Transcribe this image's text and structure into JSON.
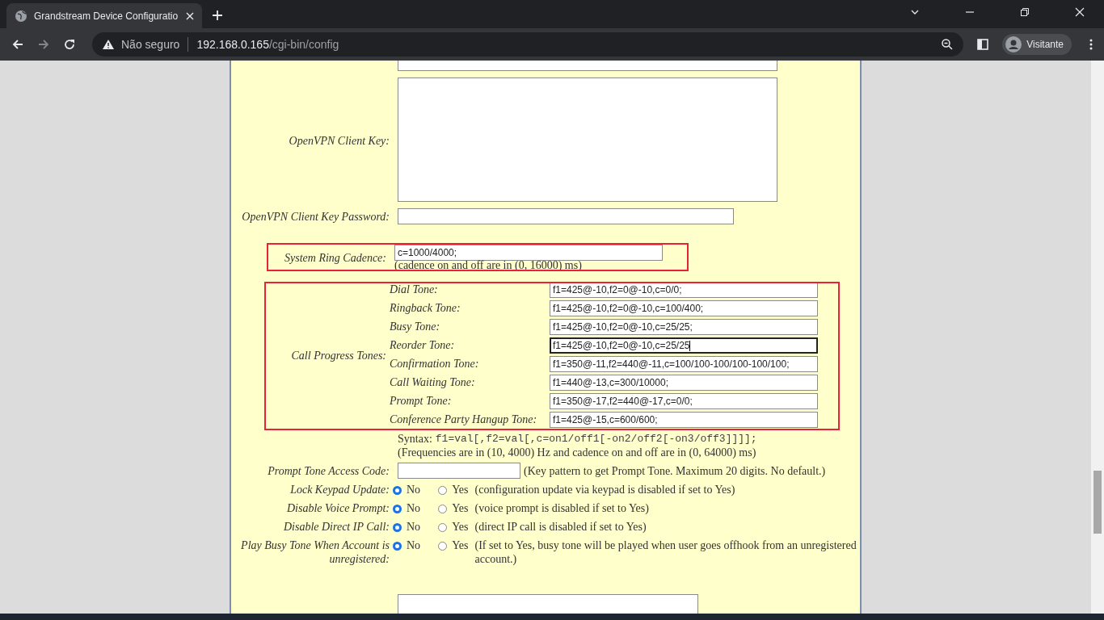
{
  "browser": {
    "tab_title": "Grandstream Device Configuratio",
    "security_label": "Não seguro",
    "url_host": "192.168.0.165",
    "url_path": "/cgi-bin/config",
    "profile_label": "Visitante"
  },
  "openvpn_key": {
    "label": "OpenVPN Client Key:"
  },
  "openvpn_key_password": {
    "label": "OpenVPN Client Key Password:"
  },
  "ring_cadence": {
    "label": "System Ring Cadence:",
    "value": "c=1000/4000;",
    "note": "(cadence on and off are in (0, 16000) ms)",
    "highlighted": true
  },
  "call_progress_tones": {
    "label": "Call Progress Tones:",
    "highlighted": true,
    "tones": [
      {
        "label": "Dial Tone:",
        "value": "f1=425@-10,f2=0@-10,c=0/0;",
        "focused": false
      },
      {
        "label": "Ringback Tone:",
        "value": "f1=425@-10,f2=0@-10,c=100/400;",
        "focused": false
      },
      {
        "label": "Busy Tone:",
        "value": "f1=425@-10,f2=0@-10,c=25/25;",
        "focused": false
      },
      {
        "label": "Reorder Tone:",
        "value": "f1=425@-10,f2=0@-10,c=25/25",
        "focused": true
      },
      {
        "label": "Confirmation Tone:",
        "value": "f1=350@-11,f2=440@-11,c=100/100-100/100-100/100;",
        "focused": false
      },
      {
        "label": "Call Waiting Tone:",
        "value": "f1=440@-13,c=300/10000;",
        "focused": false
      },
      {
        "label": "Prompt Tone:",
        "value": "f1=350@-17,f2=440@-17,c=0/0;",
        "focused": false
      },
      {
        "label": "Conference Party Hangup Tone:",
        "value": "f1=425@-15,c=600/600;",
        "focused": false
      }
    ],
    "syntax_label": "Syntax:",
    "syntax_code": "f1=val[,f2=val[,c=on1/off1[-on2/off2[-on3/off3]]]];",
    "range_note": "(Frequencies are in (10, 4000) Hz and cadence on and off are in (0, 64000) ms)"
  },
  "prompt_tone_access_code": {
    "label": "Prompt Tone Access Code:",
    "note": "(Key pattern to get Prompt Tone. Maximum 20 digits. No default.)"
  },
  "radio_settings": [
    {
      "label": "Lock Keypad Update:",
      "options": [
        {
          "label": "No",
          "selected": true
        },
        {
          "label": "Yes",
          "selected": false
        }
      ],
      "note": "(configuration update via keypad is disabled if set to Yes)"
    },
    {
      "label": "Disable Voice Prompt:",
      "options": [
        {
          "label": "No",
          "selected": true
        },
        {
          "label": "Yes",
          "selected": false
        }
      ],
      "note": "(voice prompt is disabled if set to Yes)"
    },
    {
      "label": "Disable Direct IP Call:",
      "options": [
        {
          "label": "No",
          "selected": true
        },
        {
          "label": "Yes",
          "selected": false
        }
      ],
      "note": "(direct IP call is disabled if set to Yes)"
    },
    {
      "label": "Play Busy Tone When Account is unregistered:",
      "options": [
        {
          "label": "No",
          "selected": true
        },
        {
          "label": "Yes",
          "selected": false
        }
      ],
      "note": "(If set to Yes, busy tone will be played when user goes offhook from an unregistered account.)"
    }
  ]
}
